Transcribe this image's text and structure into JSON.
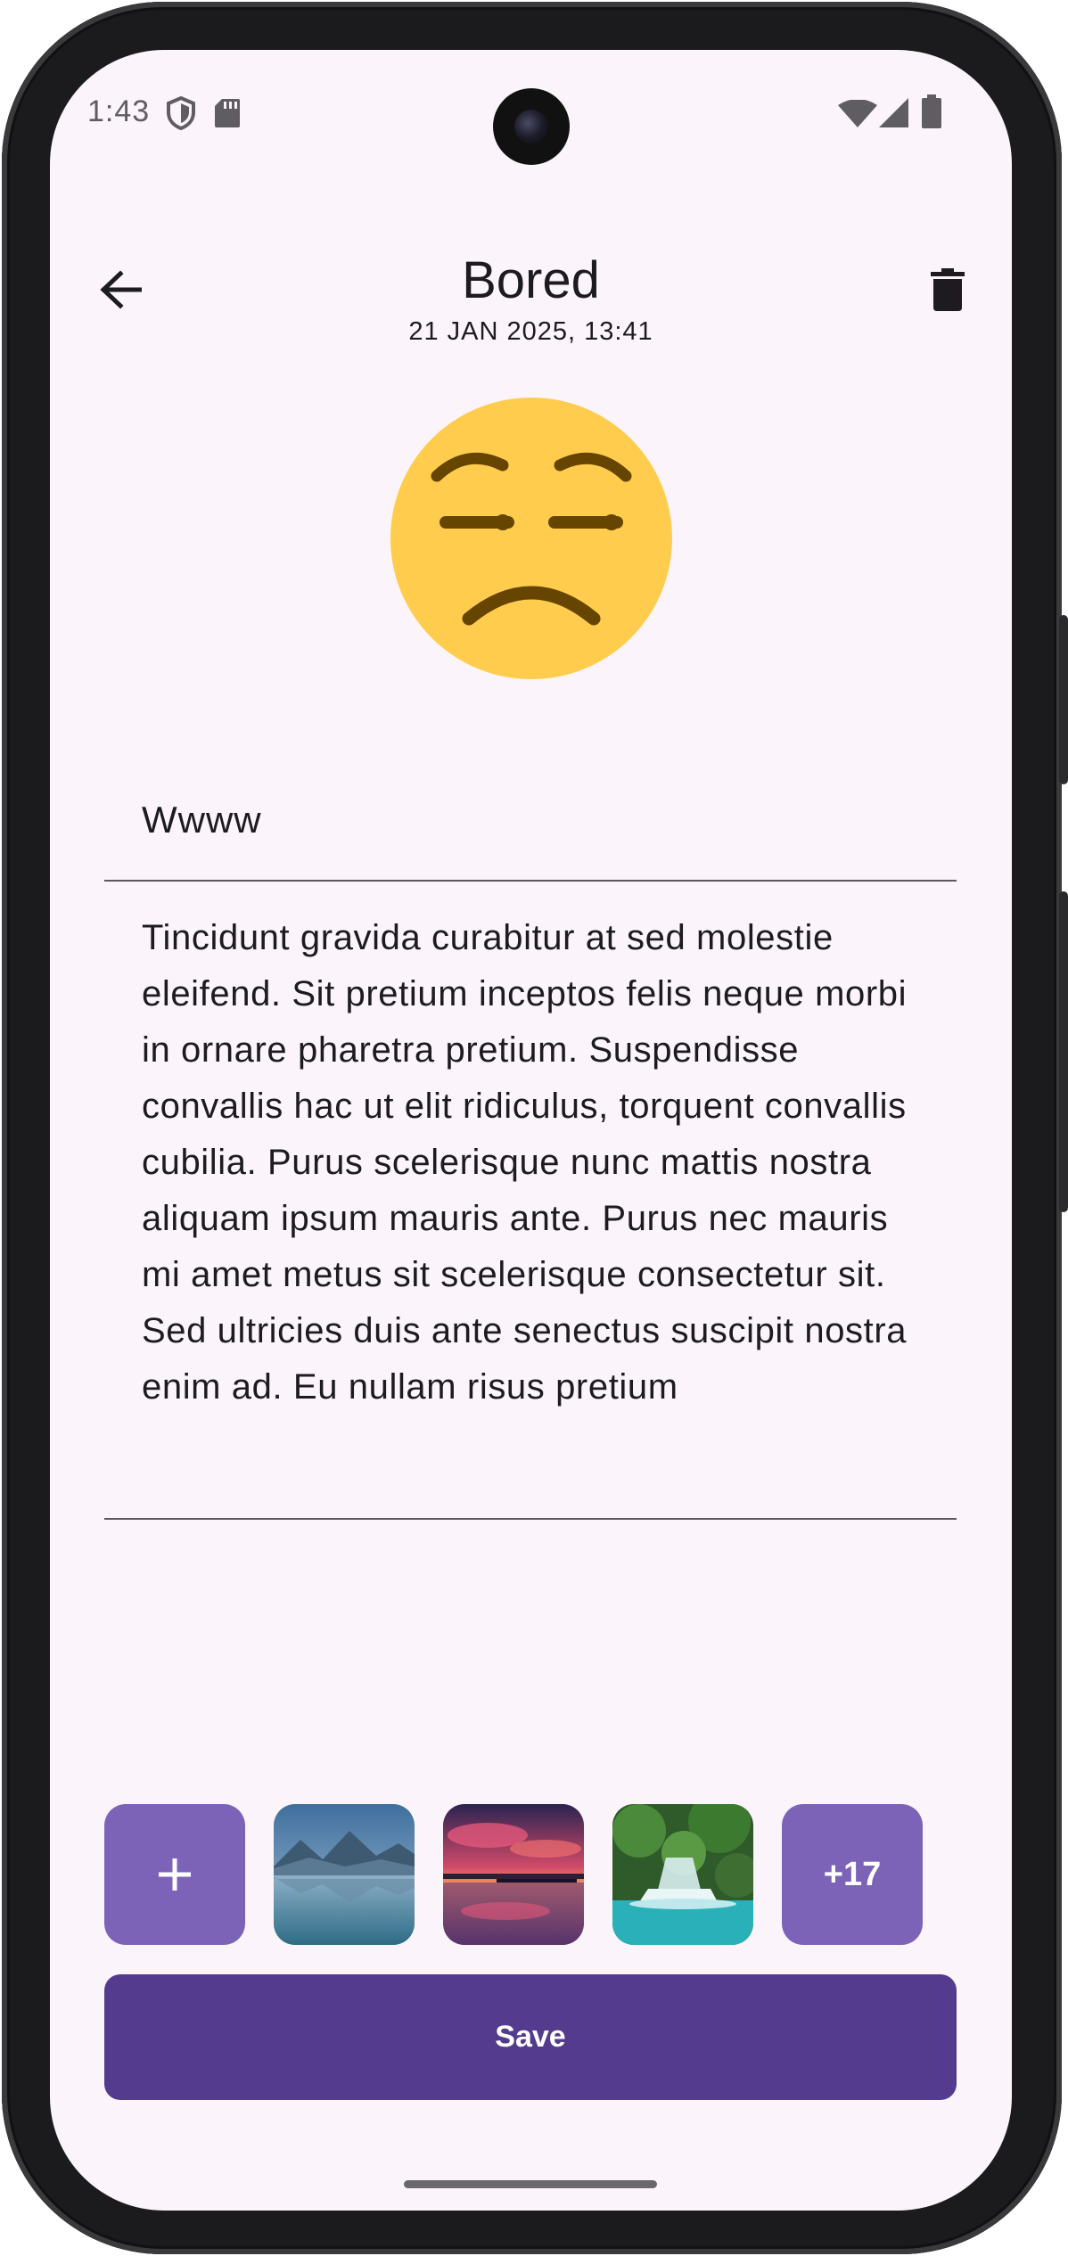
{
  "status_bar": {
    "time": "1:43"
  },
  "header": {
    "title": "Bored",
    "subtitle": "21 JAN 2025, 13:41"
  },
  "mood_icon": "bored-face-emoji",
  "form": {
    "title_value": "Wwww",
    "body_value": "Tincidunt gravida curabitur at sed molestie eleifend. Sit pretium inceptos felis neque morbi in ornare pharetra pretium. Suspendisse convallis hac ut elit ridiculus, torquent convallis cubilia. Purus scelerisque nunc mattis nostra aliquam ipsum mauris ante. Purus nec mauris mi amet metus sit scelerisque consectetur sit. Sed ultricies duis ante senectus suscipit nostra enim ad. Eu nullam risus pretium"
  },
  "attachments": {
    "add_icon": "plus-icon",
    "images": [
      "mountain-lake-image",
      "sunset-pier-image",
      "waterfall-image"
    ],
    "more_label": "+17"
  },
  "save_label": "Save",
  "colors": {
    "background": "#fbf5fb",
    "accent": "#7c63b8",
    "primary_button": "#543b8e",
    "emoji_face": "#ffcc4d",
    "emoji_features": "#664500"
  }
}
